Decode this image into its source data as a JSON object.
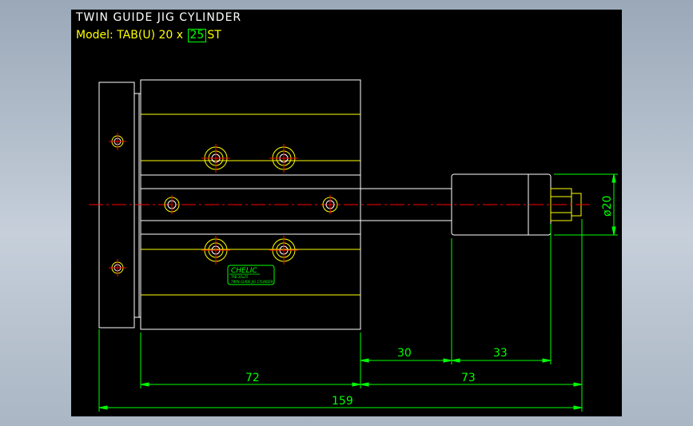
{
  "drawing": {
    "title": "TWIN GUIDE JIG CYLINDER",
    "model_prefix": "Model:",
    "model_name": "TAB(U) 20",
    "model_times": "x",
    "stroke_value": "25",
    "model_suffix": "ST"
  },
  "dimensions": {
    "d30": "30",
    "d33": "33",
    "d72": "72",
    "d73": "73",
    "d159": "159",
    "diameter": "ø20"
  },
  "nameplate": {
    "brand": "CHELIC",
    "line1": "TAB 20x25",
    "line2": "TWIN GUIDE JIG CYLINDER"
  },
  "colors": {
    "outline": "#ffffff",
    "inner_lines": "#ffff00",
    "dimension": "#00ff00",
    "centerline": "#ff0000",
    "background": "#000000"
  }
}
